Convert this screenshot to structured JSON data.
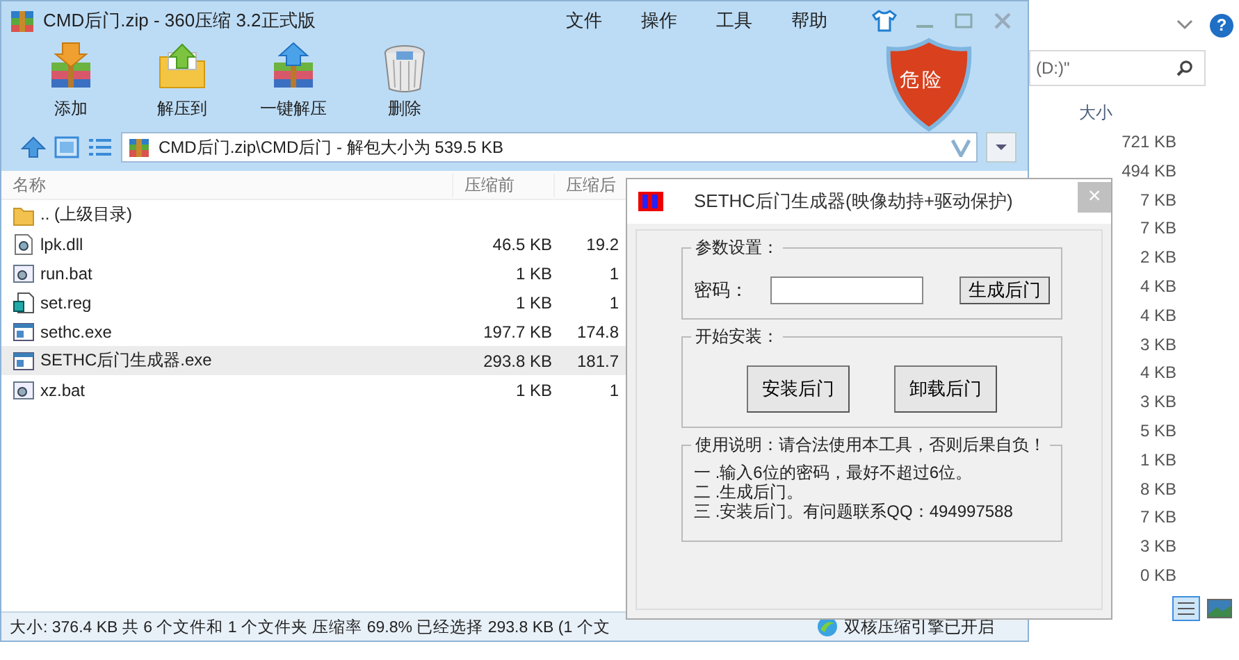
{
  "explorer": {
    "help": "?",
    "search_text": "(D:)\"",
    "column": "大小",
    "sizes": [
      "721 KB",
      "494 KB",
      "7 KB",
      "7 KB",
      "2 KB",
      "4 KB",
      "4 KB",
      "3 KB",
      "4 KB",
      "3 KB",
      "5 KB",
      "1 KB",
      "8 KB",
      "7 KB",
      "3 KB",
      "0 KB"
    ]
  },
  "archive_window": {
    "title": "CMD后门.zip - 360压缩 3.2正式版",
    "menu": [
      "文件",
      "操作",
      "工具",
      "帮助"
    ],
    "toolbar": [
      {
        "label": "添加",
        "kind": "add"
      },
      {
        "label": "解压到",
        "kind": "extract"
      },
      {
        "label": "一键解压",
        "kind": "quick"
      },
      {
        "label": "删除",
        "kind": "delete"
      }
    ],
    "risk_badge": "危险",
    "address": "CMD后门.zip\\CMD后门 - 解包大小为 539.5 KB",
    "columns": [
      "名称",
      "压缩前",
      "压缩后"
    ],
    "rows": [
      {
        "name": ".. (上级目录)",
        "before": "",
        "after": "",
        "kind": "folder",
        "selected": false
      },
      {
        "name": "lpk.dll",
        "before": "46.5 KB",
        "after": "19.2",
        "kind": "dll",
        "selected": false
      },
      {
        "name": "run.bat",
        "before": "1 KB",
        "after": "1",
        "kind": "bat",
        "selected": false
      },
      {
        "name": "set.reg",
        "before": "1 KB",
        "after": "1",
        "kind": "reg",
        "selected": false
      },
      {
        "name": "sethc.exe",
        "before": "197.7 KB",
        "after": "174.8",
        "kind": "exe",
        "selected": false
      },
      {
        "name": "SETHC后门生成器.exe",
        "before": "293.8 KB",
        "after": "181.7",
        "kind": "exe",
        "selected": true
      },
      {
        "name": "xz.bat",
        "before": "1 KB",
        "after": "1",
        "kind": "bat",
        "selected": false
      }
    ],
    "status": "大小: 376.4 KB 共 6 个文件和 1 个文件夹 压缩率 69.8% 已经选择 293.8 KB (1 个文",
    "engine_status": "双核压缩引擎已开启"
  },
  "dialog": {
    "title": "SETHC后门生成器(映像劫持+驱动保护)",
    "close": "×",
    "settings": {
      "legend": "参数设置：",
      "label": "密码：",
      "button": "生成后门"
    },
    "install": {
      "legend": "开始安装：",
      "buttons": [
        "安装后门",
        "卸载后门"
      ]
    },
    "usage": {
      "legend": "使用说明：请合法使用本工具，否则后果自负！",
      "lines": [
        "一 .输入6位的密码，最好不超过6位。",
        "二 .生成后门。",
        "三 .安装后门。有问题联系QQ：494997588"
      ]
    }
  }
}
